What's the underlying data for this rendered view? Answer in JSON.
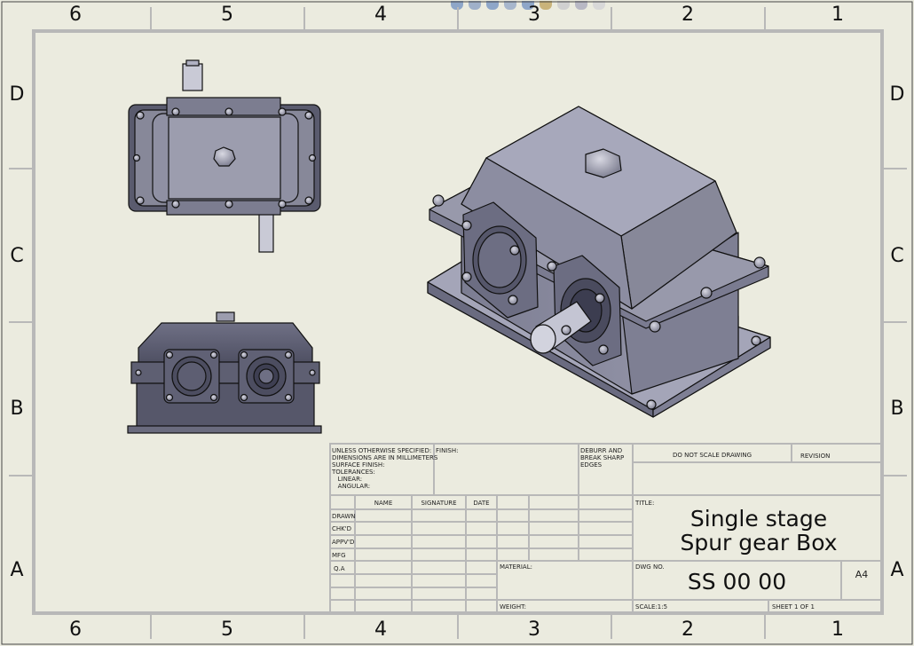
{
  "zones": {
    "columns": [
      "6",
      "5",
      "4",
      "3",
      "2",
      "1"
    ],
    "rows": [
      "D",
      "C",
      "B",
      "A"
    ]
  },
  "toolbar": {
    "icons": [
      "zoom-fit-icon",
      "zoom-area-icon",
      "previous-view-icon",
      "section-view-icon",
      "rotate-icon",
      "display-style-icon",
      "hide-show-icon",
      "appearance-icon",
      "scene-icon"
    ]
  },
  "title_block": {
    "tolerance_note": "UNLESS OTHERWISE SPECIFIED:\nDIMENSIONS ARE IN MILLIMETERS\nSURFACE FINISH:\nTOLERANCES:\n   LINEAR:\n   ANGULAR:",
    "finish_label": "FINISH:",
    "deburr_note": "DEBURR AND\nBREAK SHARP\nEDGES",
    "do_not_scale": "DO NOT SCALE DRAWING",
    "revision_label": "REVISION",
    "headers": {
      "name": "NAME",
      "signature": "SIGNATURE",
      "date": "DATE"
    },
    "roles": [
      "DRAWN",
      "CHK'D",
      "APPV'D",
      "MFG",
      "Q.A"
    ],
    "title_label": "TITLE:",
    "title": "Single stage Spur gear Box",
    "material_label": "MATERIAL:",
    "dwg_no_label": "DWG NO.",
    "dwg_no": "SS 00 00",
    "sheet_size": "A4",
    "weight_label": "WEIGHT:",
    "scale_label": "SCALE:1:5",
    "sheet_label": "SHEET 1 OF 1"
  },
  "colors": {
    "background": "#ebebdf",
    "border": "#b8b8b8",
    "model_face": "#8e8fa3",
    "model_dark": "#55566a",
    "model_light": "#b6b7c8",
    "edge": "#111111"
  }
}
